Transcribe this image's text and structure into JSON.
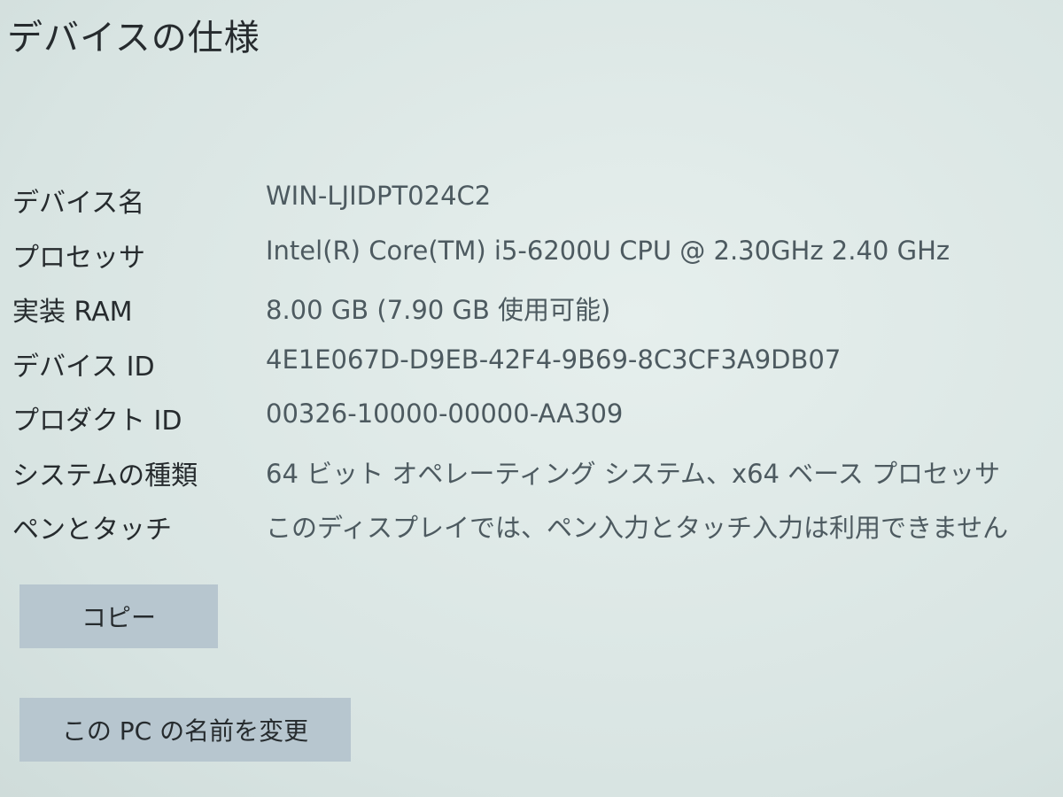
{
  "header": {
    "title": "デバイスの仕様"
  },
  "specs": [
    {
      "label": "デバイス名",
      "value": "WIN-LJIDPT024C2"
    },
    {
      "label": "プロセッサ",
      "value": "Intel(R) Core(TM) i5-6200U CPU @ 2.30GHz   2.40 GHz"
    },
    {
      "label": "実装 RAM",
      "value": "8.00 GB (7.90 GB 使用可能)"
    },
    {
      "label": "デバイス ID",
      "value": "4E1E067D-D9EB-42F4-9B69-8C3CF3A9DB07"
    },
    {
      "label": "プロダクト ID",
      "value": "00326-10000-00000-AA309"
    },
    {
      "label": "システムの種類",
      "value": "64 ビット オペレーティング システム、x64 ベース プロセッサ"
    },
    {
      "label": "ペンとタッチ",
      "value": "このディスプレイでは、ペン入力とタッチ入力は利用できません"
    }
  ],
  "buttons": {
    "copy_label": "コピー",
    "rename_label": "この PC の名前を変更"
  },
  "colors": {
    "background": "#dfe9e7",
    "button": "#b7c6cf",
    "label_text": "#262b2e",
    "value_text": "#4d5a60"
  }
}
